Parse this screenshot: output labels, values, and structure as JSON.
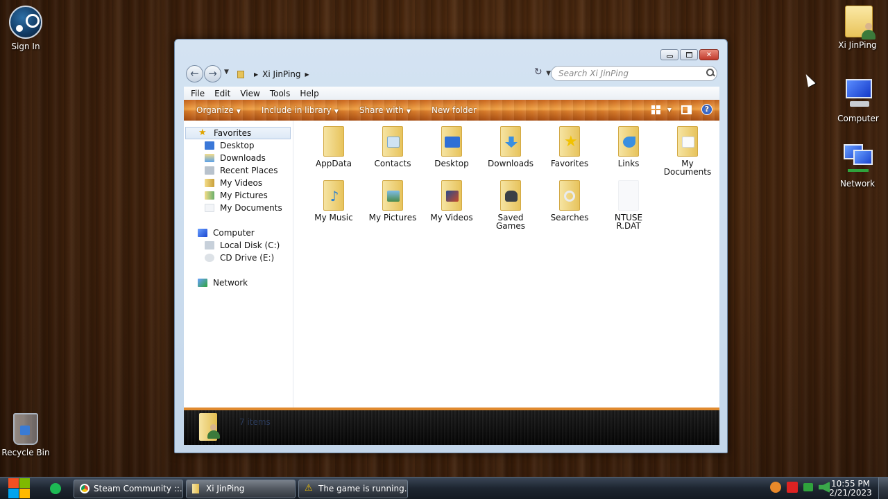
{
  "desktop": {
    "icons": {
      "sign_in": "Sign In",
      "xi_jinping": "Xi JinPing",
      "computer": "Computer",
      "network": "Network",
      "recycle_bin": "Recycle Bin"
    }
  },
  "window": {
    "breadcrumb": "Xi JinPing",
    "search_placeholder": "Search Xi JinPing",
    "menu": [
      "File",
      "Edit",
      "View",
      "Tools",
      "Help"
    ],
    "commands": {
      "organize": "Organize",
      "include_in_library": "Include in library",
      "share_with": "Share with",
      "new_folder": "New folder"
    },
    "nav": {
      "favorites": "Favorites",
      "desktop": "Desktop",
      "downloads": "Downloads",
      "recent_places": "Recent Places",
      "my_videos": "My Videos",
      "my_pictures": "My Pictures",
      "my_documents": "My Documents",
      "computer": "Computer",
      "local_disk": "Local Disk (C:)",
      "cd_drive": "CD Drive (E:)",
      "network": "Network"
    },
    "files": [
      {
        "name": "AppData",
        "icon": "folder-icon"
      },
      {
        "name": "Contacts",
        "icon": "contacts-folder-icon"
      },
      {
        "name": "Desktop",
        "icon": "desktop-folder-icon"
      },
      {
        "name": "Downloads",
        "icon": "downloads-folder-icon"
      },
      {
        "name": "Favorites",
        "icon": "favorites-folder-icon"
      },
      {
        "name": "Links",
        "icon": "links-folder-icon"
      },
      {
        "name": "My Documents",
        "icon": "documents-folder-icon"
      },
      {
        "name": "My Music",
        "icon": "music-folder-icon"
      },
      {
        "name": "My Pictures",
        "icon": "pictures-folder-icon"
      },
      {
        "name": "My Videos",
        "icon": "videos-folder-icon"
      },
      {
        "name": "Saved Games",
        "icon": "saved-games-folder-icon"
      },
      {
        "name": "Searches",
        "icon": "searches-folder-icon"
      },
      {
        "name": "NTUSER.DAT",
        "icon": "file-icon"
      }
    ],
    "details_label": "7 items"
  },
  "taskbar": {
    "spotify_icon": "spotify-icon",
    "tasks": {
      "chrome": "Steam Community ::...",
      "explorer": "Xi JinPing",
      "game": "The game is running..."
    },
    "clock": {
      "time": "10:55 PM",
      "date": "2/21/2023"
    }
  }
}
